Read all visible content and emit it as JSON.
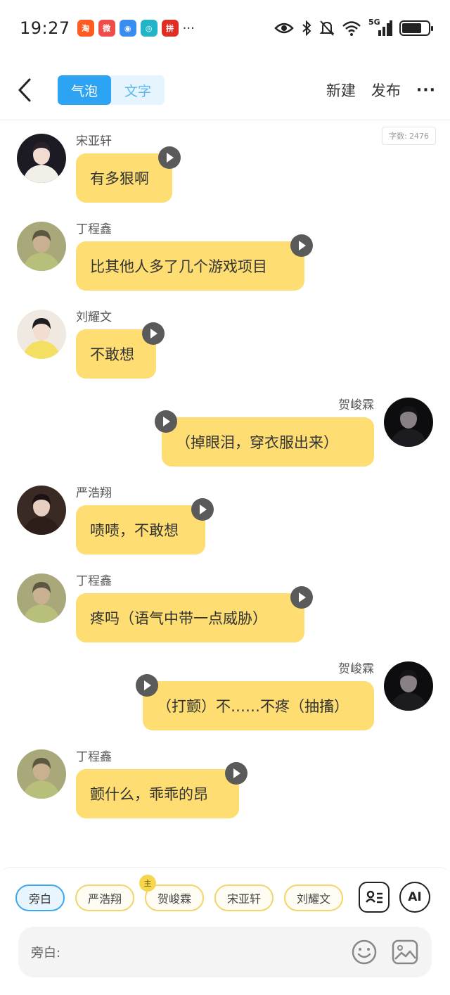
{
  "status_bar": {
    "time": "19:27",
    "apps": [
      {
        "icon": "taobao-app-icon",
        "glyph": "淘",
        "color": "#ff5a1f"
      },
      {
        "icon": "weibo-app-icon",
        "glyph": "微",
        "color": "#f04b4b"
      },
      {
        "icon": "browser-app-icon",
        "glyph": "◉",
        "color": "#3a8df0"
      },
      {
        "icon": "store-app-icon",
        "glyph": "◎",
        "color": "#22b5c7"
      },
      {
        "icon": "pinduoduo-app-icon",
        "glyph": "拼",
        "color": "#e02e24"
      }
    ],
    "more": "···",
    "network": "5G"
  },
  "header": {
    "tabs": [
      {
        "label": "气泡",
        "active": true
      },
      {
        "label": "文字",
        "active": false
      }
    ],
    "new_label": "新建",
    "publish_label": "发布",
    "more_label": "···"
  },
  "word_count": {
    "label": "字数:",
    "value": "2476"
  },
  "messages": [
    {
      "side": "left",
      "name": "宋亚轩",
      "text": "有多狠啊",
      "avatar": "songyaxuan"
    },
    {
      "side": "left",
      "name": "丁程鑫",
      "text": "比其他人多了几个游戏项目",
      "avatar": "dingchengxin"
    },
    {
      "side": "left",
      "name": "刘耀文",
      "text": "不敢想",
      "avatar": "liuyaowen"
    },
    {
      "side": "right",
      "name": "贺峻霖",
      "text": "（掉眼泪，穿衣服出来）",
      "avatar": "hejunlin"
    },
    {
      "side": "left",
      "name": "严浩翔",
      "text": "啧啧，不敢想",
      "avatar": "yanhaoxiang"
    },
    {
      "side": "left",
      "name": "丁程鑫",
      "text": "疼吗（语气中带一点威胁）",
      "avatar": "dingchengxin"
    },
    {
      "side": "right",
      "name": "贺峻霖",
      "text": "（打颤）不……不疼（抽搐）",
      "avatar": "hejunlin"
    },
    {
      "side": "left",
      "name": "丁程鑫",
      "text": "颤什么，乖乖的昂",
      "avatar": "dingchengxin"
    }
  ],
  "characters": [
    {
      "label": "旁白",
      "active": true
    },
    {
      "label": "严浩翔",
      "active": false
    },
    {
      "label": "贺峻霖",
      "active": false,
      "badge": "主"
    },
    {
      "label": "宋亚轩",
      "active": false
    },
    {
      "label": "刘耀文",
      "active": false
    }
  ],
  "ai_label": "AI",
  "input": {
    "label": "旁白:",
    "value": ""
  },
  "colors": {
    "accent": "#2da4f3",
    "bubble": "#fedd72",
    "chip_border": "#f2d46a"
  }
}
